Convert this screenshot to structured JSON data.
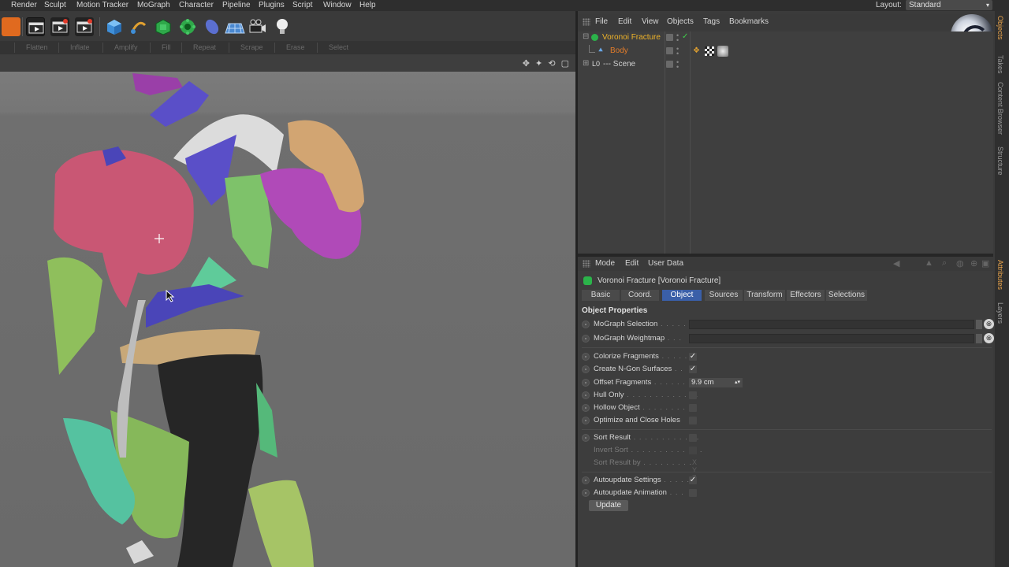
{
  "menu": [
    "Render",
    "Sculpt",
    "Motion Tracker",
    "MoGraph",
    "Character",
    "Pipeline",
    "Plugins",
    "Script",
    "Window",
    "Help"
  ],
  "layout": {
    "label": "Layout:",
    "value": "Standard"
  },
  "brush_tools": [
    "Flatten",
    "Inflate",
    "Amplify",
    "Fill",
    "Repeat",
    "Scrape",
    "Erase",
    "Select"
  ],
  "objects_manager": {
    "menu": [
      "File",
      "Edit",
      "View",
      "Objects",
      "Tags",
      "Bookmarks"
    ],
    "items": [
      {
        "name": "Voronoi Fracture",
        "color": "#f0b429",
        "icon": "voronoi-fracture-icon"
      },
      {
        "name": "Body",
        "color": "#e07b2a",
        "icon": "polygon-object-icon"
      },
      {
        "name": "--- Scene",
        "color": "#cfcfcf",
        "icon": "null-object-icon",
        "prefix": "L0"
      }
    ]
  },
  "side_tabs": [
    "Objects",
    "Takes",
    "Content Browser",
    "Structure",
    "Attributes",
    "Layers"
  ],
  "attributes": {
    "menu": [
      "Mode",
      "Edit",
      "User Data"
    ],
    "title": "Voronoi Fracture [Voronoi Fracture]",
    "tabs": [
      "Basic",
      "Coord.",
      "Object",
      "Sources",
      "Transform",
      "Effectors",
      "Selections"
    ],
    "active_tab": "Object",
    "section": "Object Properties",
    "link_fields": [
      {
        "label": "MoGraph Selection",
        "leader": " . . . . ."
      },
      {
        "label": "MoGraph Weightmap",
        "leader": " . . ."
      }
    ],
    "options": [
      {
        "label": "Colorize Fragments",
        "leader": " . . . . .",
        "checked": true
      },
      {
        "label": "Create N-Gon Surfaces",
        "leader": " . .",
        "checked": true
      },
      {
        "label": "Offset Fragments",
        "leader": " . . . . . . .",
        "value": "9.9 cm"
      },
      {
        "label": "Hull Only",
        "leader": " . . . . . . . . . . . . .",
        "checked": false
      },
      {
        "label": "Hollow Object",
        "leader": " . . . . . . . . . .",
        "checked": false
      },
      {
        "label": "Optimize and Close Holes",
        "leader": "",
        "checked": false
      }
    ],
    "sort_options": [
      {
        "label": "Sort Result",
        "leader": " . . . . . . . . . . . .",
        "checked": false,
        "dim": false
      },
      {
        "label": "Invert Sort",
        "leader": " . . . . . . . . . . . . .",
        "checked": false,
        "dim": true
      },
      {
        "label": "Sort Result by",
        "leader": " . . . . . . . . .",
        "dim": true,
        "axes": "X  Y  Z"
      }
    ],
    "auto_options": [
      {
        "label": "Autoupdate Settings",
        "leader": " . . . . .",
        "checked": true
      },
      {
        "label": "Autoupdate Animation",
        "leader": " . . .",
        "checked": false
      }
    ],
    "update_button": "Update"
  },
  "check_mark": "✓"
}
